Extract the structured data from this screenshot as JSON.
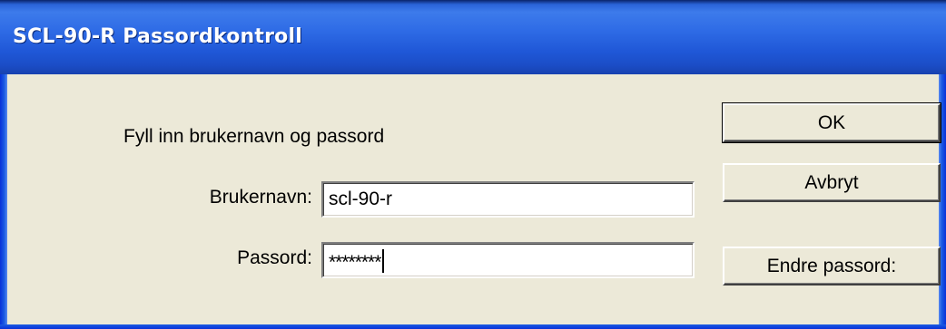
{
  "window": {
    "title": "SCL-90-R Passordkontroll"
  },
  "form": {
    "instruction": "Fyll inn brukernavn og passord",
    "username_label": "Brukernavn:",
    "username_value": "scl-90-r",
    "password_label": "Passord:",
    "password_masked": "********"
  },
  "buttons": {
    "ok": "OK",
    "cancel": "Avbryt",
    "change_password": "Endre passord:"
  },
  "colors": {
    "titlebar": "#2F6CE6",
    "client_background": "#ECE9D8",
    "title_text": "#FFFFFF"
  }
}
